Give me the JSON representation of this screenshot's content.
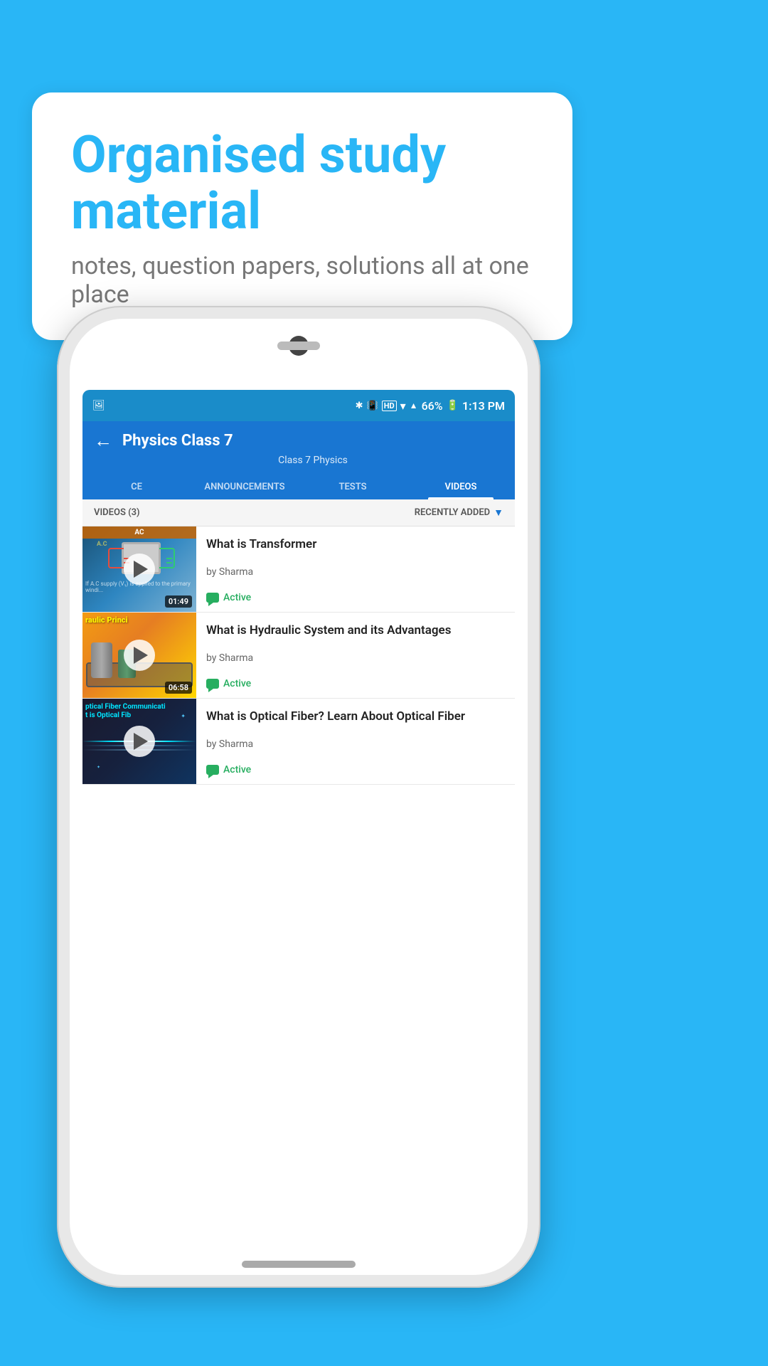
{
  "page": {
    "background_color": "#29b6f6"
  },
  "speech_bubble": {
    "title": "Organised study material",
    "subtitle": "notes, question papers, solutions all at one place"
  },
  "phone": {
    "status_bar": {
      "battery": "66%",
      "time": "1:13 PM",
      "signal_icons": "HD"
    },
    "app_bar": {
      "title": "Physics Class 7",
      "breadcrumb": "Class 7   Physics",
      "back_label": "←"
    },
    "tabs": [
      {
        "label": "CE",
        "active": false
      },
      {
        "label": "ANNOUNCEMENTS",
        "active": false
      },
      {
        "label": "TESTS",
        "active": false
      },
      {
        "label": "VIDEOS",
        "active": true
      }
    ],
    "filter_bar": {
      "count_label": "VIDEOS (3)",
      "sort_label": "RECENTLY ADDED"
    },
    "videos": [
      {
        "title": "What is  Transformer",
        "author": "by Sharma",
        "status": "Active",
        "duration": "01:49",
        "thumb_type": "transformer"
      },
      {
        "title": "What is Hydraulic System and its Advantages",
        "author": "by Sharma",
        "status": "Active",
        "duration": "06:58",
        "thumb_type": "hydraulic",
        "thumb_text": "raulic Princi"
      },
      {
        "title": "What is Optical Fiber? Learn About Optical Fiber",
        "author": "by Sharma",
        "status": "Active",
        "duration": "",
        "thumb_type": "optical",
        "thumb_text": "ptical Fiber Communicati",
        "thumb_text2": "t is Optical Fib"
      }
    ]
  }
}
